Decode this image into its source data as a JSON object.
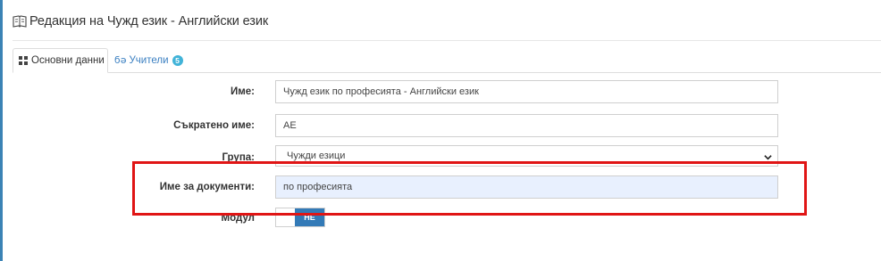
{
  "header": {
    "title": "Редакция на Чужд език - Английски език",
    "icon": "book-icon"
  },
  "tabs": [
    {
      "label": "Основни данни",
      "icon": "grid-icon",
      "active": true
    },
    {
      "label": "Учители",
      "icon": "users-icon",
      "badge": "5",
      "active": false
    }
  ],
  "form": {
    "name": {
      "label": "Име:",
      "value": "Чужд език по професията - Английски език"
    },
    "short_name": {
      "label": "Съкратено име:",
      "value": "АЕ"
    },
    "group": {
      "label": "Група:",
      "value": "Чужди езици"
    },
    "doc_name": {
      "label": "Име за документи:",
      "value": "по професията"
    },
    "module": {
      "label": "Модул",
      "toggle_label": "НЕ",
      "state": "off"
    }
  },
  "colors": {
    "accent": "#337ab7",
    "badge": "#41b3d8",
    "annotation": "#e01515",
    "autofill": "#e8f0fe"
  }
}
